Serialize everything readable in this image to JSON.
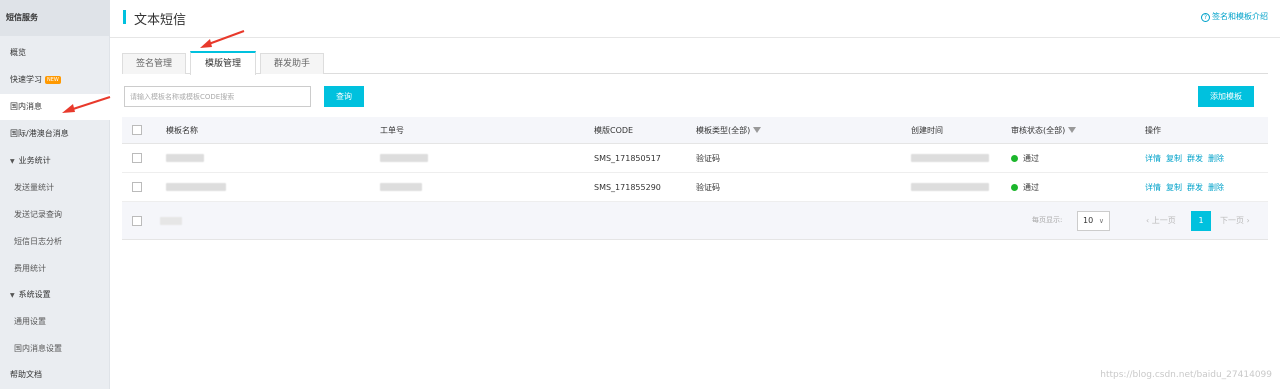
{
  "sidebar": {
    "header": "短信服务",
    "items": [
      {
        "label": "概览",
        "kind": "item"
      },
      {
        "label": "快速学习",
        "kind": "item",
        "badge": "NEW"
      },
      {
        "label": "国内消息",
        "kind": "item",
        "active": true
      },
      {
        "label": "国际/港澳台消息",
        "kind": "item"
      },
      {
        "label": "业务统计",
        "kind": "group"
      },
      {
        "label": "发送量统计",
        "kind": "sub"
      },
      {
        "label": "发送记录查询",
        "kind": "sub"
      },
      {
        "label": "短信日志分析",
        "kind": "sub"
      },
      {
        "label": "费用统计",
        "kind": "sub"
      },
      {
        "label": "系统设置",
        "kind": "group"
      },
      {
        "label": "通用设置",
        "kind": "sub"
      },
      {
        "label": "国内消息设置",
        "kind": "sub"
      },
      {
        "label": "帮助文档",
        "kind": "item"
      }
    ]
  },
  "header": {
    "title": "文本短信",
    "help_link": "签名和模板介绍"
  },
  "tabs": [
    {
      "label": "签名管理",
      "active": false
    },
    {
      "label": "模版管理",
      "active": true
    },
    {
      "label": "群发助手",
      "active": false
    }
  ],
  "toolbar": {
    "search_placeholder": "请输入模板名称或模板CODE搜索",
    "search_button": "查询",
    "add_button": "添加模板"
  },
  "table": {
    "columns": {
      "name": "模板名称",
      "ticket": "工单号",
      "code": "模版CODE",
      "type": "模板类型(全部)",
      "created": "创建时间",
      "status": "审核状态(全部)",
      "actions": "操作"
    },
    "rows": [
      {
        "code": "SMS_171850517",
        "type": "验证码",
        "status": "通过"
      },
      {
        "code": "SMS_171855290",
        "type": "验证码",
        "status": "通过"
      }
    ],
    "row_actions": [
      "详情",
      "复制",
      "群发",
      "删除"
    ],
    "status_color": "#1cb62c"
  },
  "pagination": {
    "page_size_label": "每页显示:",
    "page_size": "10",
    "prev": "上一页",
    "current_page": "1",
    "next": "下一页"
  },
  "watermark": "https://blog.csdn.net/baidu_27414099",
  "colors": {
    "accent": "#00c1de",
    "link": "#00a2ca",
    "annotation_arrow": "#e8392b"
  }
}
